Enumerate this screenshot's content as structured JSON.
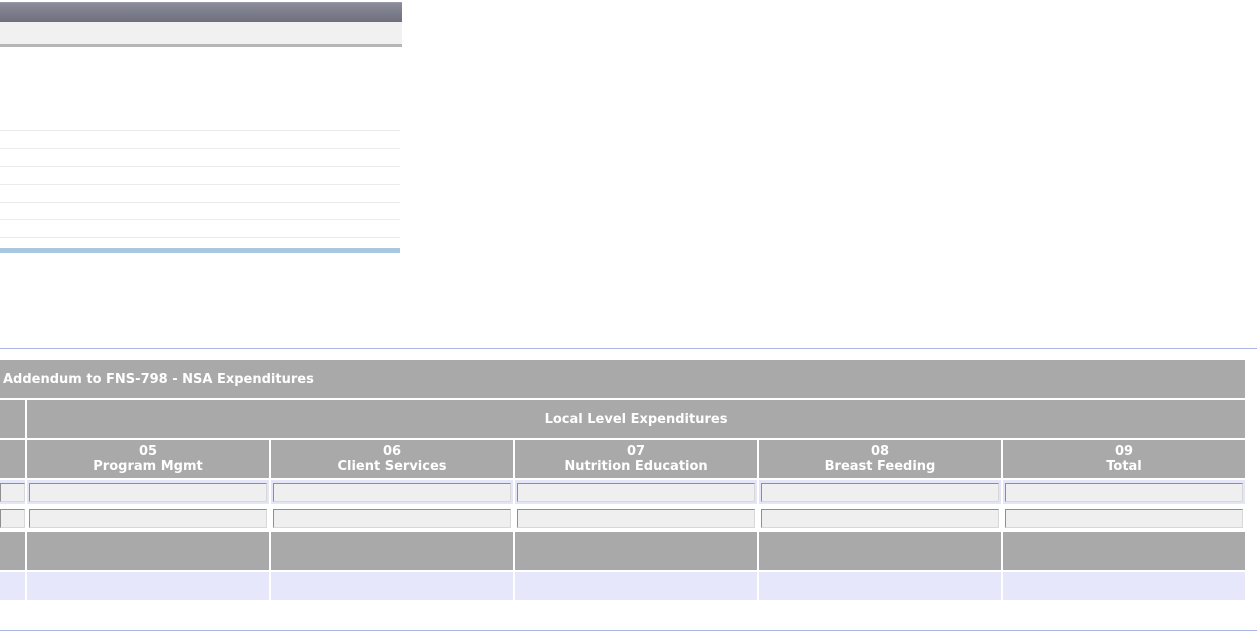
{
  "form": {
    "title": "Addendum to FNS-798 - NSA Expenditures",
    "group_header": "Local Level Expenditures",
    "columns": [
      {
        "code": "05",
        "label": "Program Mgmt"
      },
      {
        "code": "06",
        "label": "Client Services"
      },
      {
        "code": "07",
        "label": "Nutrition Education"
      },
      {
        "code": "08",
        "label": "Breast Feeding"
      },
      {
        "code": "09",
        "label": "Total"
      }
    ],
    "row1_values": [
      "",
      "",
      "",
      "",
      ""
    ],
    "row2_values": [
      "",
      "",
      "",
      "",
      ""
    ]
  }
}
